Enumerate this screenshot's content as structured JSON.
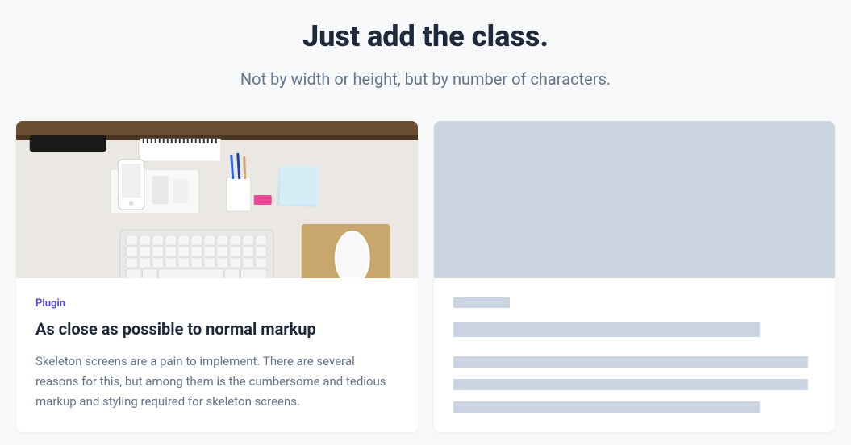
{
  "header": {
    "title": "Just add the class.",
    "subtitle": "Not by width or height, but by number of characters."
  },
  "card": {
    "tag": "Plugin",
    "title": "As close as possible to normal markup",
    "description": "Skeleton screens are a pain to implement. There are several reasons for this, but among them is the cumbersome and tedious markup and styling required for skeleton screens."
  }
}
